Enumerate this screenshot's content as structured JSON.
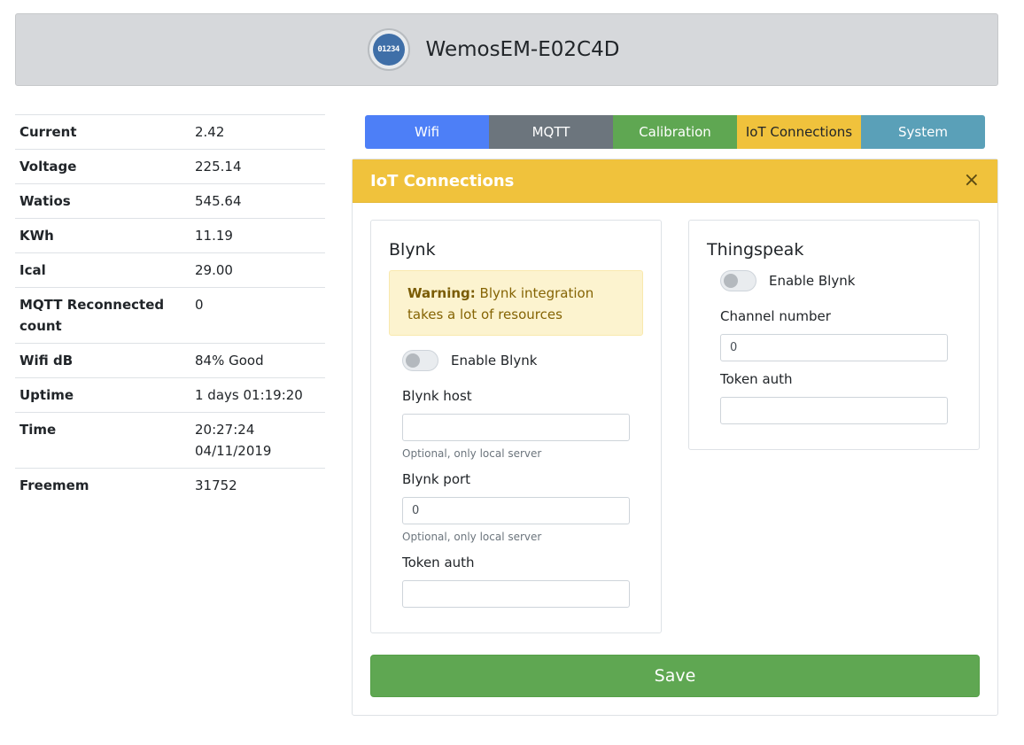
{
  "header": {
    "logo_text": "01234",
    "title": "WemosEM-E02C4D"
  },
  "stats": [
    {
      "label": "Current",
      "value": "2.42"
    },
    {
      "label": "Voltage",
      "value": "225.14"
    },
    {
      "label": "Watios",
      "value": "545.64"
    },
    {
      "label": "KWh",
      "value": "11.19"
    },
    {
      "label": "Ical",
      "value": "29.00"
    },
    {
      "label": "MQTT Reconnected count",
      "value": "0"
    },
    {
      "label": "Wifi dB",
      "value": "84% Good"
    },
    {
      "label": "Uptime",
      "value": "1 days 01:19:20"
    },
    {
      "label": "Time",
      "value": "20:27:24 04/11/2019"
    },
    {
      "label": "Freemem",
      "value": "31752"
    }
  ],
  "tabs": {
    "wifi": "Wifi",
    "mqtt": "MQTT",
    "calibration": "Calibration",
    "iot": "IoT Connections",
    "system": "System"
  },
  "card": {
    "title": "IoT Connections",
    "close": "×",
    "blynk": {
      "title": "Blynk",
      "warning_strong": "Warning:",
      "warning_text": " Blynk integration takes a lot of resources",
      "enable_label": "Enable Blynk",
      "host_label": "Blynk host",
      "host_value": "",
      "host_help": "Optional, only local server",
      "port_label": "Blynk port",
      "port_value": "0",
      "port_help": "Optional, only local server",
      "token_label": "Token auth",
      "token_value": ""
    },
    "thingspeak": {
      "title": "Thingspeak",
      "enable_label": "Enable Blynk",
      "channel_label": "Channel number",
      "channel_value": "0",
      "token_label": "Token auth",
      "token_value": ""
    },
    "save_label": "Save"
  },
  "colors": {
    "wifi_tab": "#4d7ff7",
    "mqtt_tab": "#6c757d",
    "calibration_tab": "#5fa752",
    "iot_tab": "#f0c23c",
    "system_tab": "#5aa0b8",
    "save_button": "#5fa752"
  }
}
